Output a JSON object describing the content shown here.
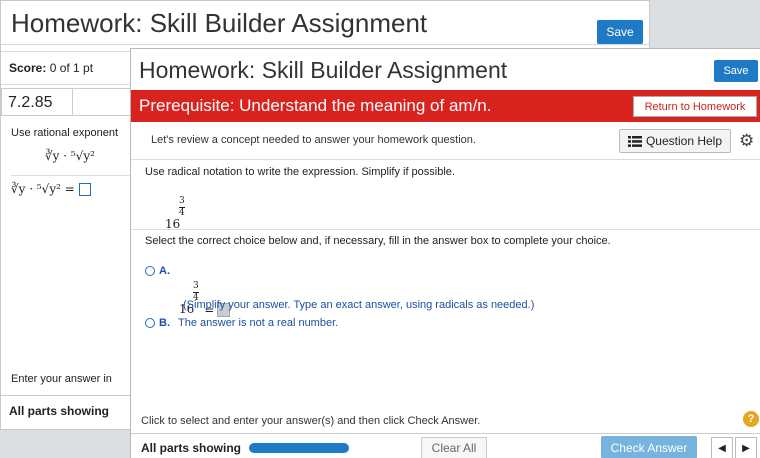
{
  "back_window": {
    "title": "Homework: Skill Builder Assignment",
    "save_label": "Save",
    "score_label": "Score:",
    "score_value": "0 of 1 pt",
    "question_number": "7.2.85",
    "instruction": "Use rational exponent",
    "expr_top": "∛y · ⁵√y²",
    "expr_answer": "∛y · ⁵√y² =",
    "enter_answer": "Enter your answer in",
    "parts_showing": "All parts showing"
  },
  "front_window": {
    "title": "Homework: Skill Builder Assignment",
    "save_label": "Save",
    "prerequisite": "Prerequisite: Understand the meaning of am/n.",
    "return_label": "Return to Homework",
    "review_text": "Let's review a concept needed to answer your homework question.",
    "question_help_label": "Question Help",
    "instruction": "Use radical notation to write the expression. Simplify if possible.",
    "expression": {
      "base": "16",
      "exp_num": "3",
      "exp_den": "4"
    },
    "select_text": "Select the correct choice below and, if necessary, fill in the answer box to complete your choice.",
    "option_a_label": "A.",
    "option_a_equals": "=",
    "simplify_note": "(Simplify your answer. Type an exact answer, using radicals as needed.)",
    "option_b_label": "B.",
    "option_b_text": "The answer is not a real number.",
    "click_instruction": "Click to select and enter your answer(s) and then click Check Answer.",
    "help_glyph": "?",
    "parts_showing": "All parts showing",
    "progress_fraction": 1.0,
    "clear_all_label": "Clear All",
    "check_answer_label": "Check Answer",
    "prev_glyph": "◀",
    "next_glyph": "▶"
  },
  "colors": {
    "accent_blue": "#1f7ac6",
    "prereq_red": "#d9231f",
    "link_blue": "#1d4fa3"
  },
  "icons": [
    "list-icon",
    "gear-icon",
    "help-icon",
    "prev-arrow-icon",
    "next-arrow-icon"
  ]
}
